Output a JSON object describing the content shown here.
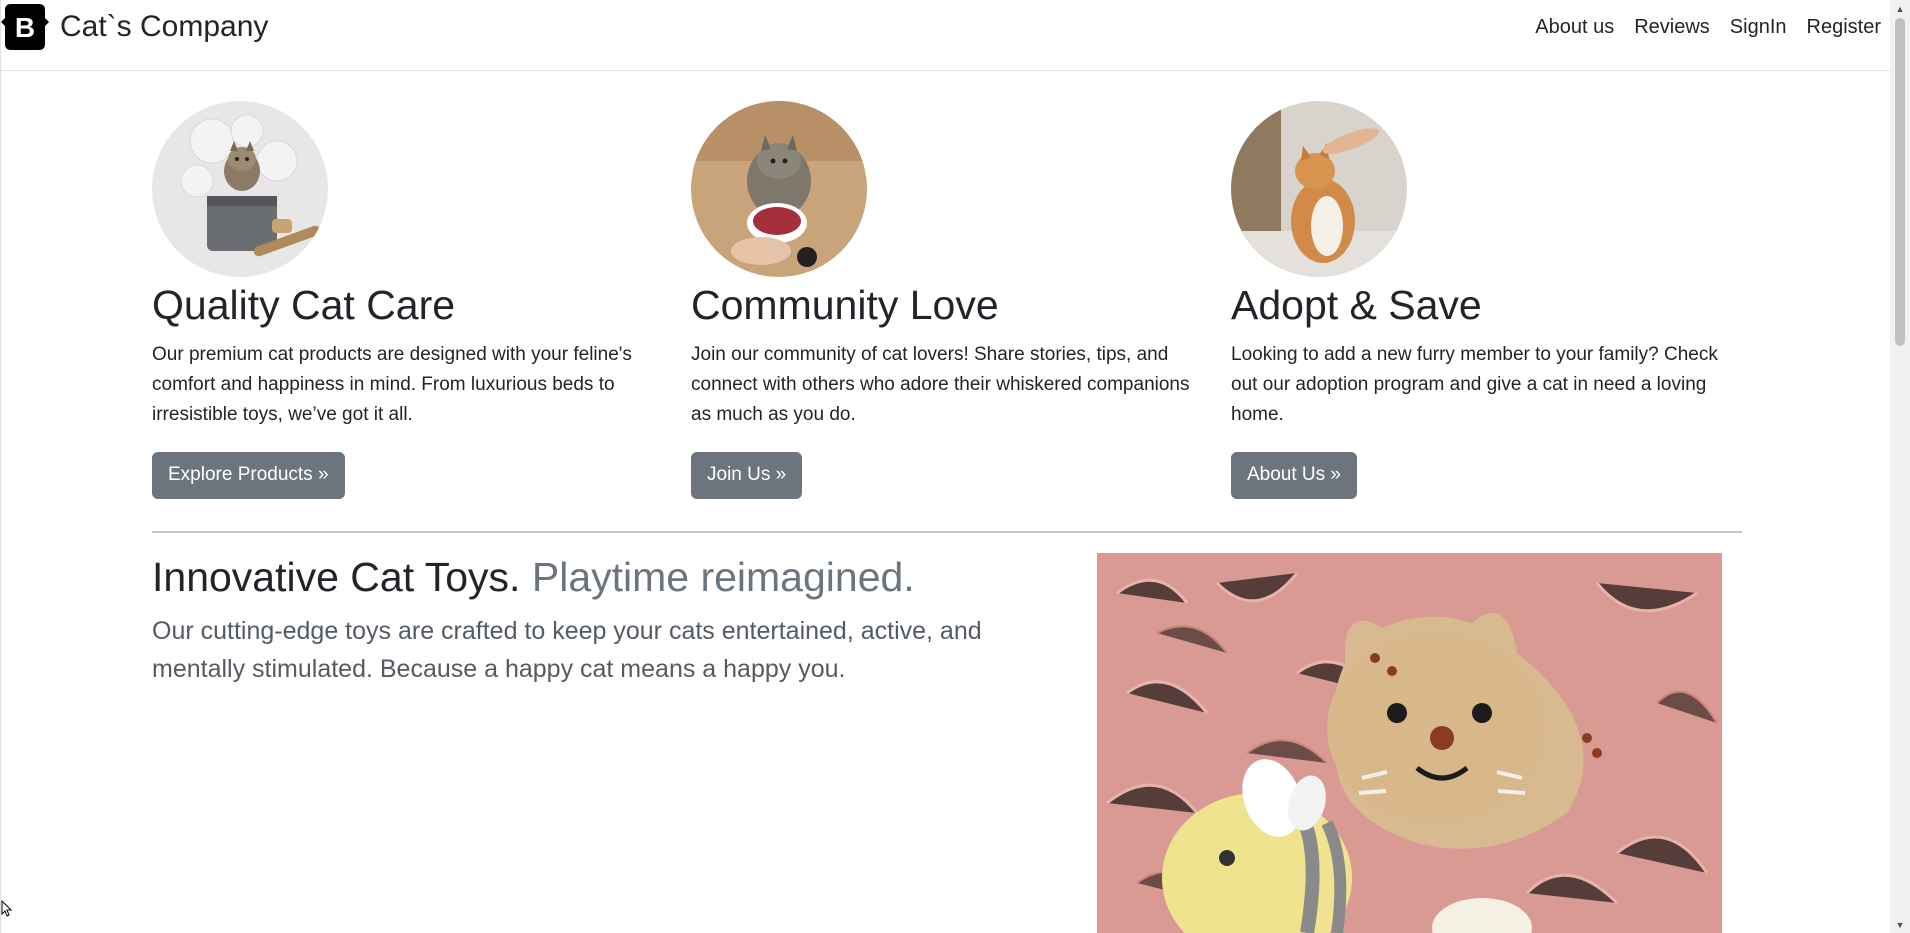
{
  "header": {
    "brand_name": "Cat`s Company",
    "logo_letter": "B",
    "nav": [
      {
        "label": "About us"
      },
      {
        "label": "Reviews"
      },
      {
        "label": "SignIn"
      },
      {
        "label": "Register"
      }
    ]
  },
  "features": [
    {
      "title": "Quality Cat Care",
      "text": "Our premium cat products are designed with your feline's comfort and happiness in mind. From luxurious beds to irresistible toys, we’ve got it all.",
      "button": "Explore Products »"
    },
    {
      "title": "Community Love",
      "text": "Join our community of cat lovers! Share stories, tips, and connect with others who adore their whiskered companions as much as you do.",
      "button": "Join Us »"
    },
    {
      "title": "Adopt & Save",
      "text": "Looking to add a new furry member to your family? Check out our adoption program and give a cat in need a loving home.",
      "button": "About Us »"
    }
  ],
  "featurette": {
    "heading": "Innovative Cat Toys.",
    "heading_muted": "Playtime reimagined.",
    "lead": "Our cutting-edge toys are crafted to keep your cats entertained, active, and mentally stimulated. Because a happy cat means a happy you."
  },
  "colors": {
    "button_bg": "#6c757d",
    "logo_bg": "#000000",
    "text": "#212529"
  }
}
